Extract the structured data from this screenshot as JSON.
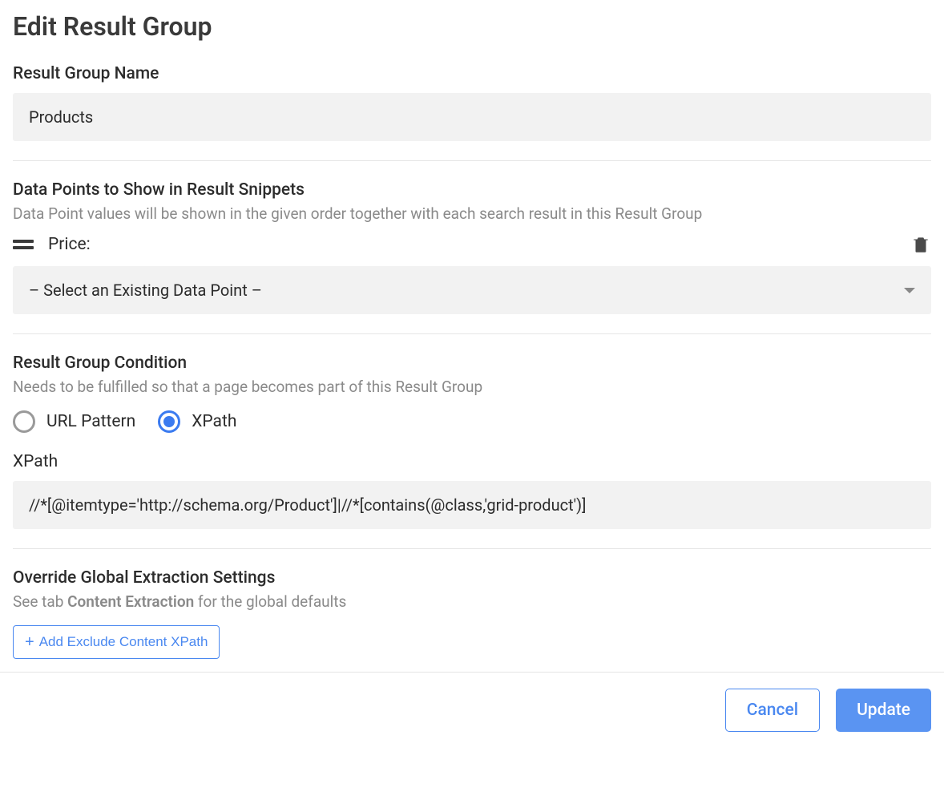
{
  "page_title": "Edit Result Group",
  "result_group_name": {
    "label": "Result Group Name",
    "value": "Products"
  },
  "data_points": {
    "label": "Data Points to Show in Result Snippets",
    "sublabel": "Data Point values will be shown in the given order together with each search result in this Result Group",
    "items": [
      {
        "label": "Price:"
      }
    ],
    "select_placeholder": "– Select an Existing Data Point –"
  },
  "condition": {
    "label": "Result Group Condition",
    "sublabel": "Needs to be fulfilled so that a page becomes part of this Result Group",
    "options": [
      {
        "label": "URL Pattern",
        "checked": false
      },
      {
        "label": "XPath",
        "checked": true
      }
    ],
    "xpath_label": "XPath",
    "xpath_value": "//*[@itemtype='http://schema.org/Product']|//*[contains(@class,'grid-product')]"
  },
  "override": {
    "label": "Override Global Extraction Settings",
    "sublabel_pre": "See tab ",
    "sublabel_strong": "Content Extraction",
    "sublabel_post": " for the global defaults",
    "add_button": "Add Exclude Content XPath"
  },
  "footer": {
    "cancel": "Cancel",
    "update": "Update"
  }
}
